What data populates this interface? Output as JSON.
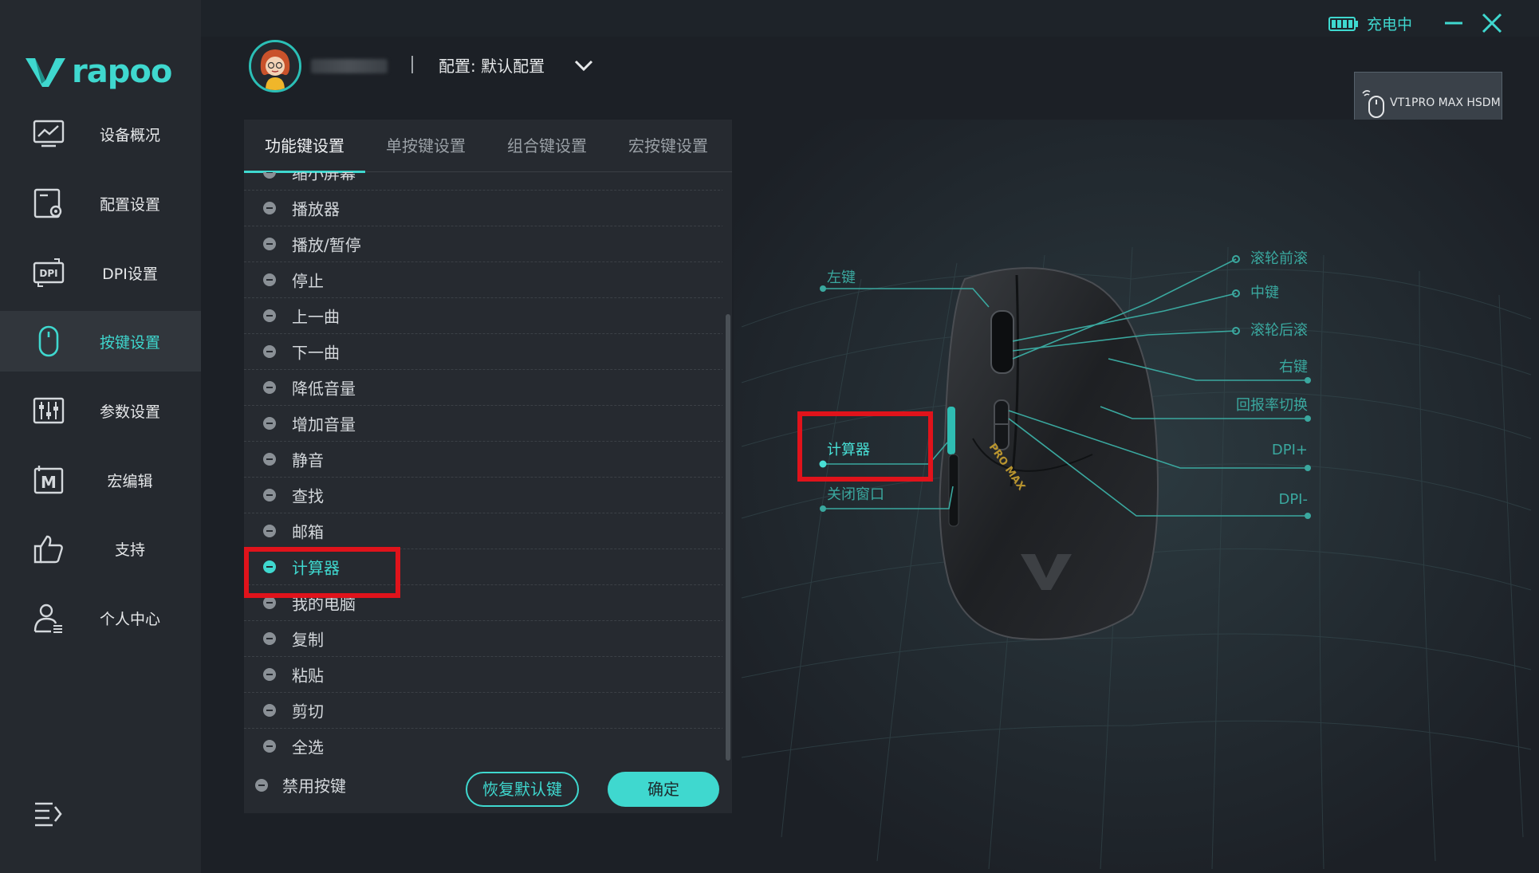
{
  "app": {
    "brand": "rapoo"
  },
  "sidebar": {
    "items": [
      {
        "label": "设备概况",
        "icon": "monitor-chart-icon"
      },
      {
        "label": "配置设置",
        "icon": "config-settings-icon"
      },
      {
        "label": "DPI设置",
        "icon": "dpi-icon"
      },
      {
        "label": "按键设置",
        "icon": "mouse-icon",
        "active": true
      },
      {
        "label": "参数设置",
        "icon": "sliders-icon"
      },
      {
        "label": "宏编辑",
        "icon": "macro-icon"
      },
      {
        "label": "支持",
        "icon": "thumbs-up-icon"
      },
      {
        "label": "个人中心",
        "icon": "user-center-icon"
      }
    ]
  },
  "topbar": {
    "charge_text": "充电中"
  },
  "header": {
    "config_label": "配置: 默认配置"
  },
  "device": {
    "name": "VT1PRO MAX HSDM",
    "type": "MOUSE"
  },
  "tabs": [
    "功能键设置",
    "单按键设置",
    "组合键设置",
    "宏按键设置"
  ],
  "functions": [
    "缩小屏幕",
    "播放器",
    "播放/暂停",
    "停止",
    "上一曲",
    "下一曲",
    "降低音量",
    "增加音量",
    "静音",
    "查找",
    "邮箱",
    "计算器",
    "我的电脑",
    "复制",
    "粘贴",
    "剪切",
    "全选"
  ],
  "selected_function": "计算器",
  "footer": {
    "disable_label": "禁用按键",
    "restore_label": "恢复默认键",
    "confirm_label": "确定"
  },
  "diagram": {
    "left_callouts": [
      "左键",
      "计算器",
      "关闭窗口"
    ],
    "right_callouts": [
      "滚轮前滚",
      "中键",
      "滚轮后滚",
      "右键",
      "回报率切换",
      "DPI+",
      "DPI-"
    ],
    "mouse_text": "PRO MAX"
  },
  "colors": {
    "accent": "#3fd8cf",
    "highlight": "#e0131b",
    "sidebar_bg": "#25292f",
    "panel_bg": "#262a30"
  }
}
